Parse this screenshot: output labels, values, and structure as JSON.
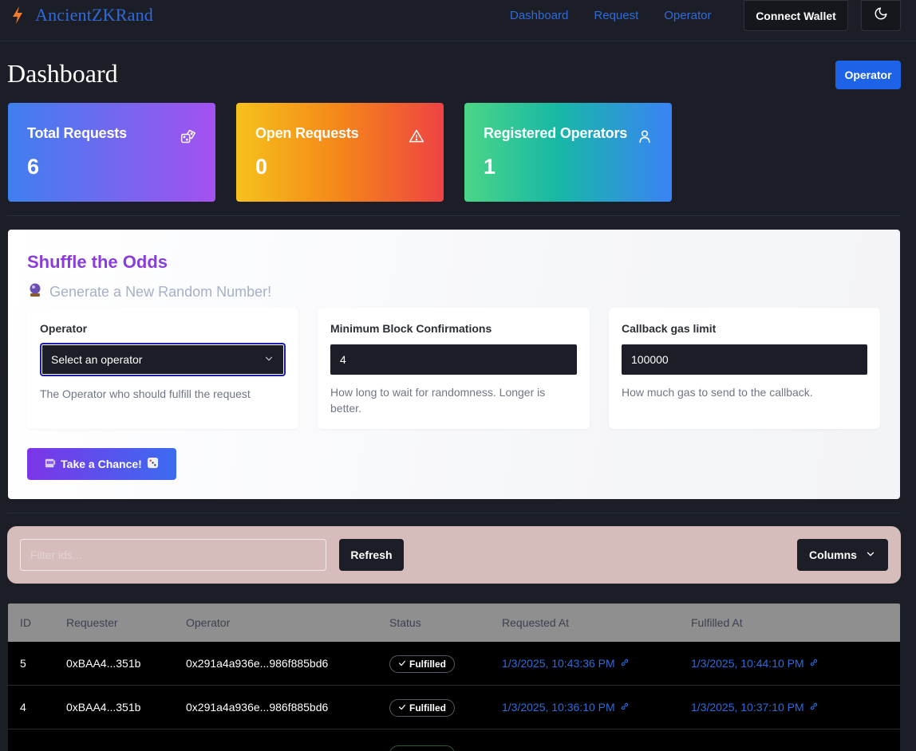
{
  "navbar": {
    "brand": "AncientZKRand",
    "links": [
      "Dashboard",
      "Request",
      "Operator"
    ],
    "connect_wallet": "Connect Wallet"
  },
  "header": {
    "title": "Dashboard",
    "operator_button": "Operator"
  },
  "stats": [
    {
      "label": "Total Requests",
      "value": "6"
    },
    {
      "label": "Open Requests",
      "value": "0"
    },
    {
      "label": "Registered Operators",
      "value": "1"
    }
  ],
  "form": {
    "title": "Shuffle the Odds",
    "subtitle": "Generate a New Random Number!",
    "fields": [
      {
        "label": "Operator",
        "value": "Select an operator",
        "help": "The Operator who should fulfill the request"
      },
      {
        "label": "Minimum Block Confirmations",
        "value": "4",
        "help": "How long to wait for randomness. Longer is better."
      },
      {
        "label": "Callback gas limit",
        "value": "100000",
        "help": "How much gas to send to the callback."
      }
    ],
    "submit": "Take a Chance!"
  },
  "toolbar": {
    "filter_placeholder": "Filter ids...",
    "refresh": "Refresh",
    "columns": "Columns"
  },
  "table": {
    "headers": [
      "ID",
      "Requester",
      "Operator",
      "Status",
      "Requested At",
      "Fulfilled At"
    ],
    "rows": [
      {
        "id": "5",
        "requester": "0xBAA4...351b",
        "operator": "0x291a4a936e...986f885bd6",
        "status": "Fulfilled",
        "requested_at": "1/3/2025, 10:43:36 PM",
        "fulfilled_at": "1/3/2025, 10:44:10 PM"
      },
      {
        "id": "4",
        "requester": "0xBAA4...351b",
        "operator": "0x291a4a936e...986f885bd6",
        "status": "Fulfilled",
        "requested_at": "1/3/2025, 10:36:10 PM",
        "fulfilled_at": "1/3/2025, 10:37:10 PM"
      }
    ]
  },
  "colors": {
    "accent": "#1d63e8",
    "link": "#2f6bd8",
    "form_title": "#8a3cdc"
  }
}
